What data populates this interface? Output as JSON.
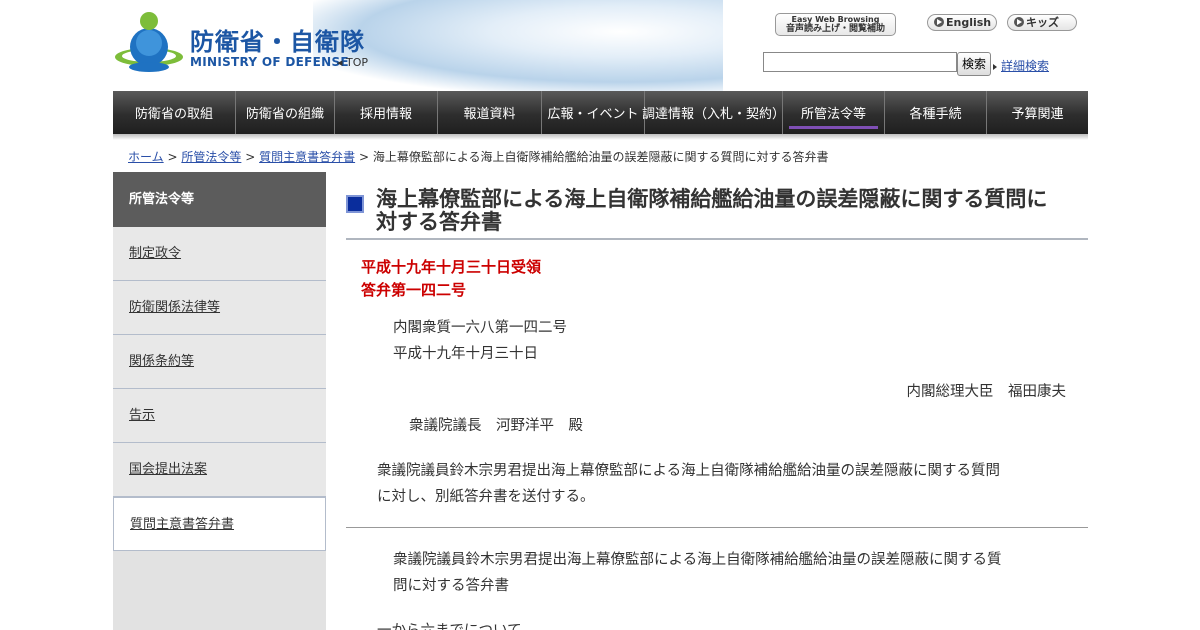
{
  "header": {
    "logo_jp": "防衛省・自衛隊",
    "logo_en": "MINISTRY OF DEFENSE",
    "top_link": "TOP",
    "easy_web_top": "Easy Web Browsing",
    "easy_web_bottom": "音声読み上げ・閲覧補助",
    "english": "English",
    "kids": "キッズ",
    "search_button": "検索",
    "advanced_search": "詳細検索"
  },
  "nav": {
    "items": [
      {
        "label": "防衛省の取組"
      },
      {
        "label": "防衛省の組織"
      },
      {
        "label": "採用情報"
      },
      {
        "label": "報道資料"
      },
      {
        "label": "広報・イベント"
      },
      {
        "label": "調達情報（入札・契約）"
      },
      {
        "label": "所管法令等"
      },
      {
        "label": "各種手続"
      },
      {
        "label": "予算関連"
      }
    ]
  },
  "breadcrumb": {
    "home": "ホーム",
    "sep": ">",
    "level1": "所管法令等",
    "level2": "質問主意書答弁書",
    "current": "海上幕僚監部による海上自衛隊補給艦給油量の誤差隠蔽に関する質問に対する答弁書"
  },
  "sidebar": {
    "heading": "所管法令等",
    "items": [
      {
        "label": "制定政令"
      },
      {
        "label": "防衛関係法律等"
      },
      {
        "label": "関係条約等"
      },
      {
        "label": "告示"
      },
      {
        "label": "国会提出法案"
      },
      {
        "label": "質問主意書答弁書"
      }
    ]
  },
  "content": {
    "title_line1": "海上幕僚監部による海上自衛隊補給艦給油量の誤差隠蔽に関する質問に",
    "title_line2": "対する答弁書",
    "received": "平成十九年十月三十日受領",
    "answer_no": "答弁第一四二号",
    "cabinet_no": "内閣衆質一六八第一四二号",
    "date": "平成十九年十月三十日",
    "signatory": "内閣総理大臣　福田康夫",
    "addressee": "衆議院議長　河野洋平　殿",
    "para1_line1": "衆議院議員鈴木宗男君提出海上幕僚監部による海上自衛隊補給艦給油量の誤差隠蔽に関する質問",
    "para1_line2": "に対し、別紙答弁書を送付する。",
    "para2_line1": "衆議院議員鈴木宗男君提出海上幕僚監部による海上自衛隊補給艦給油量の誤差隠蔽に関する質",
    "para2_line2": "問に対する答弁書",
    "cut_line": "一から六までについて"
  }
}
